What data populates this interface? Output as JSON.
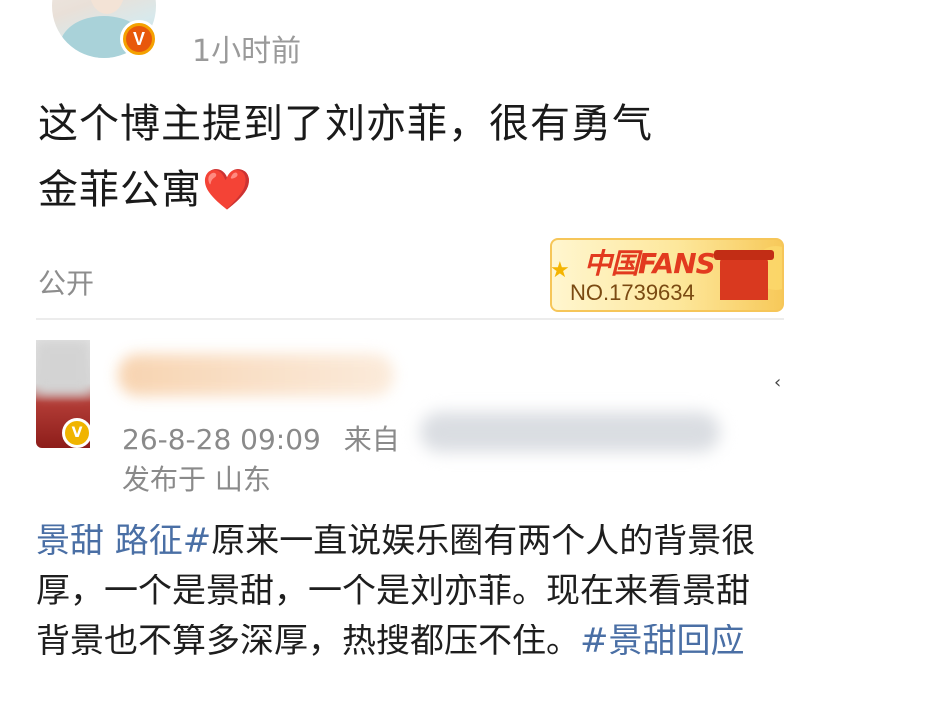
{
  "post": {
    "time": "1小时前",
    "text_line1": "这个博主提到了刘亦菲，很有勇气",
    "text_line2": "金菲公寓",
    "heart": "❤️",
    "visibility": "公开",
    "fan_badge": {
      "title": "中国FANS",
      "number": "NO.1739634"
    }
  },
  "quoted": {
    "timestamp": "26-8-28 09:09",
    "source_prefix": "来自",
    "location": "发布于 山东",
    "body": {
      "line1_hashtag": "景甜 路征#",
      "line1_text": "原来一直说娱乐圈有两个人的背景很",
      "line2_text": "厚，一个是景甜，一个是刘亦菲。现在来看景甜",
      "line3_text": "背景也不算多深厚，热搜都压不住。",
      "line3_hashtag": "#景甜回应"
    }
  },
  "colors": {
    "hashtag": "#4a6fa5",
    "meta_gray": "#8a8a8a",
    "badge_orange": "#f4a100"
  },
  "icons": [
    "verified-v-icon",
    "heart-emoji",
    "star-icon",
    "tiananmen-icon",
    "chevron-icon"
  ]
}
